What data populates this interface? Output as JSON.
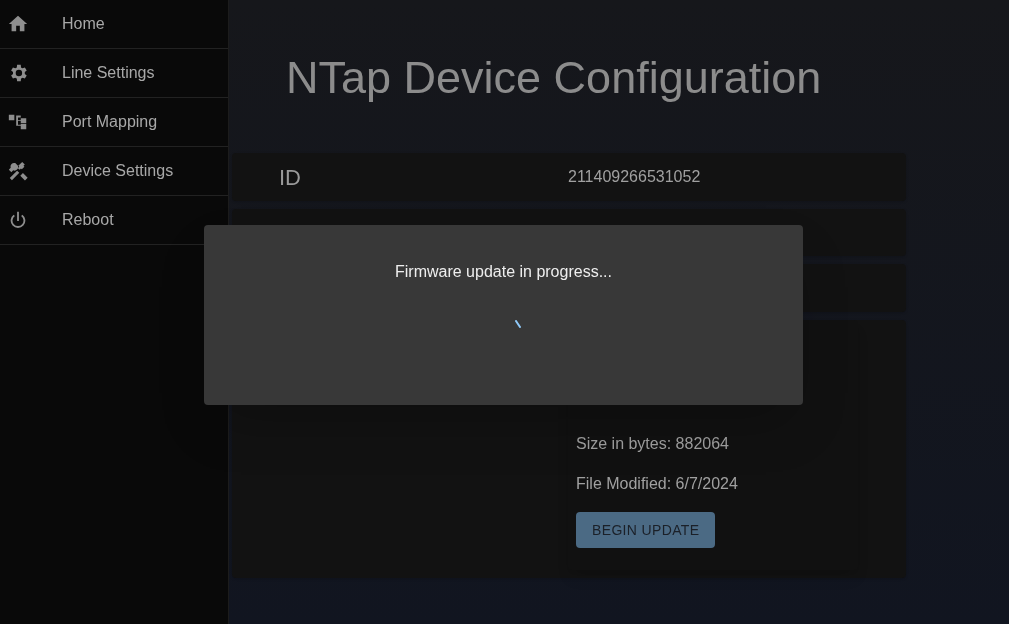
{
  "sidebar": {
    "items": [
      {
        "label": "Home"
      },
      {
        "label": "Line Settings"
      },
      {
        "label": "Port Mapping"
      },
      {
        "label": "Device Settings"
      },
      {
        "label": "Reboot"
      }
    ]
  },
  "title": "NTap Device Configuration",
  "info_rows": [
    {
      "label": "ID",
      "value": "211409266531052"
    }
  ],
  "update_card": {
    "lines": [
      "Size in bytes: 882064",
      "File Modified: 6/7/2024"
    ],
    "button": "BEGIN UPDATE"
  },
  "dialog": {
    "message": "Firmware update in progress..."
  }
}
